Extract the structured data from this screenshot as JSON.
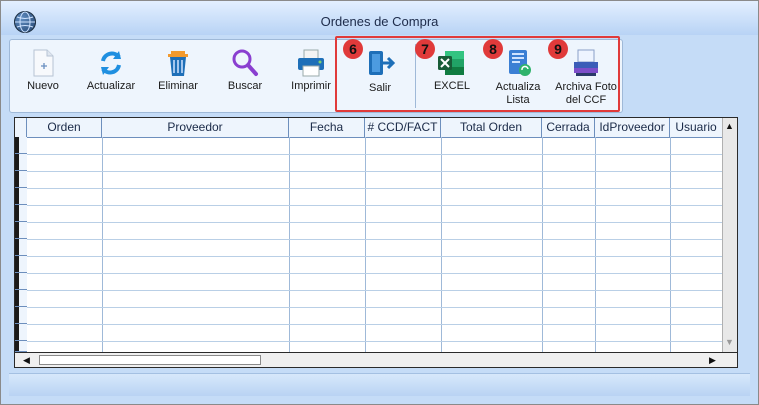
{
  "window": {
    "title": "Ordenes de Compra"
  },
  "toolbar": {
    "nuevo": "Nuevo",
    "actualizar": "Actualizar",
    "eliminar": "Eliminar",
    "buscar": "Buscar",
    "imprimir": "Imprimir",
    "salir": "Salir",
    "excel": "EXCEL",
    "actualiza_lista_1": "Actualiza",
    "actualiza_lista_2": "Lista",
    "archiva_1": "Archiva Foto",
    "archiva_2": "del CCF"
  },
  "callouts": {
    "six": "6",
    "seven": "7",
    "eight": "8",
    "nine": "9"
  },
  "grid": {
    "headers": [
      "Orden",
      "Proveedor",
      "Fecha",
      "# CCD/FACT",
      "Total Orden",
      "Cerrada",
      "IdProveedor",
      "Usuario"
    ]
  },
  "icons": {
    "nuevo": "new-document-icon",
    "actualizar": "refresh-icon",
    "eliminar": "trash-icon",
    "buscar": "magnifier-icon",
    "imprimir": "printer-icon",
    "salir": "exit-door-icon",
    "excel": "excel-icon",
    "actualiza": "update-list-icon",
    "archiva": "scanner-icon"
  },
  "colors": {
    "accent_red": "#e03a3a",
    "window_bg": "#c5dcf7",
    "toolbar_bg": "#eef5fd"
  }
}
